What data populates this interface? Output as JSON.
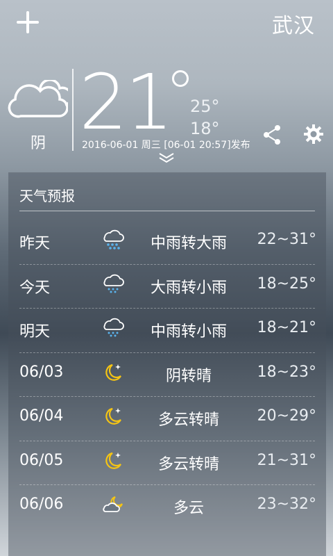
{
  "header": {
    "city": "武汉",
    "add_icon": "plus-icon"
  },
  "current": {
    "condition": "阴",
    "temp": "21",
    "high": "25°",
    "low": "18°",
    "date_line": "2016-06-01 周三 [06-01 20:57]发布",
    "icons": [
      "cloud-icon",
      "share-icon",
      "gear-icon",
      "chevron-down-icon"
    ]
  },
  "forecast": {
    "title": "天气预报",
    "rows": [
      {
        "day": "昨天",
        "condition": "中雨转大雨",
        "range": "22~31°",
        "icon": "heavy-rain-icon"
      },
      {
        "day": "今天",
        "condition": "大雨转小雨",
        "range": "18~25°",
        "icon": "rain-icon"
      },
      {
        "day": "明天",
        "condition": "中雨转小雨",
        "range": "18~21°",
        "icon": "rain-icon"
      },
      {
        "day": "06/03",
        "condition": "阴转晴",
        "range": "18~23°",
        "icon": "moon-icon"
      },
      {
        "day": "06/04",
        "condition": "多云转晴",
        "range": "20~29°",
        "icon": "moon-icon"
      },
      {
        "day": "06/05",
        "condition": "多云转晴",
        "range": "21~31°",
        "icon": "moon-icon"
      },
      {
        "day": "06/06",
        "condition": "多云",
        "range": "23~32°",
        "icon": "cloud-moon-icon"
      }
    ]
  },
  "colors": {
    "icon_blue": "#5ab4ee",
    "moon_yellow": "#f4c414"
  }
}
